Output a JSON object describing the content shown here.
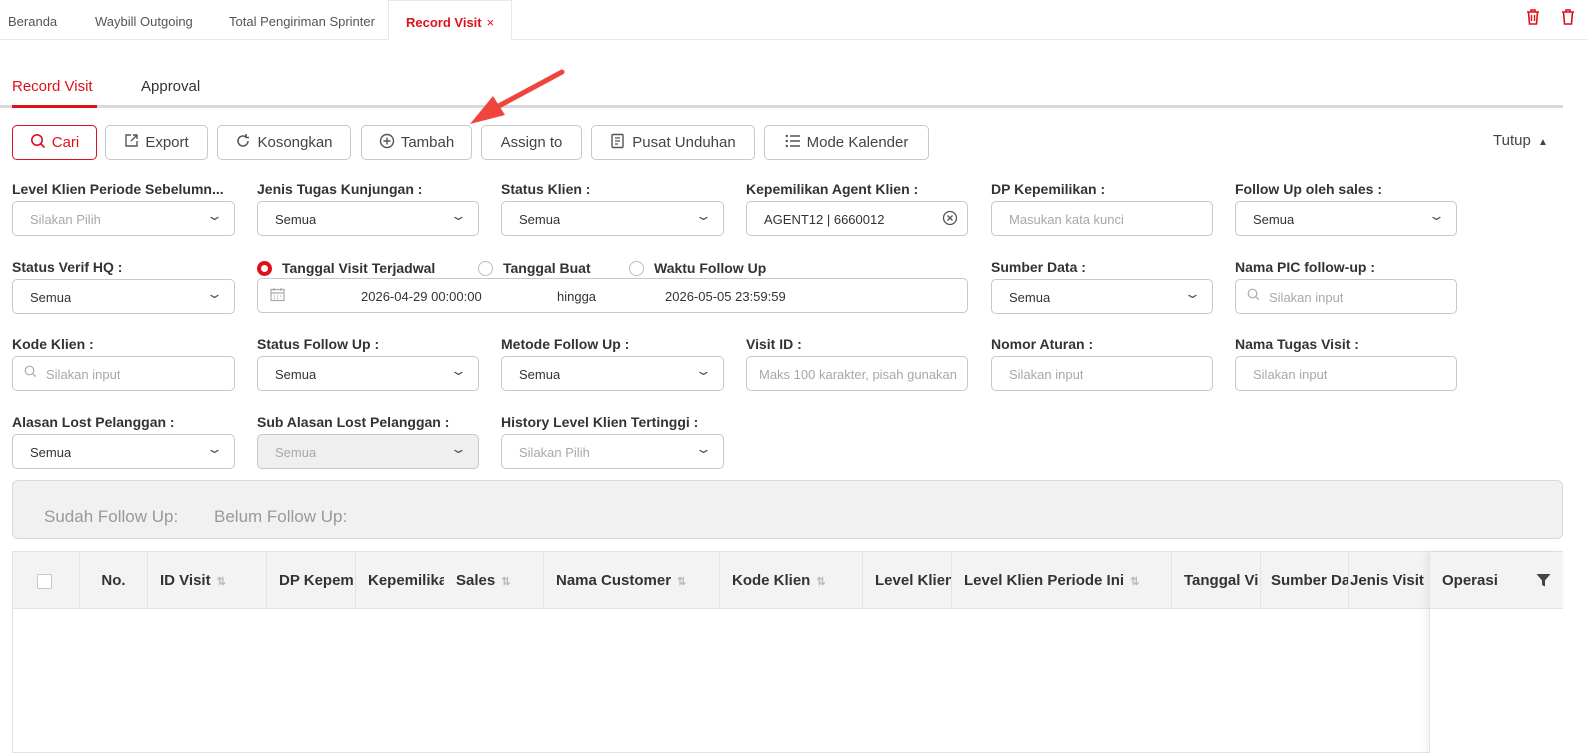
{
  "tabs": [
    "Beranda",
    "Waybill Outgoing",
    "Total Pengiriman Sprinter",
    "Record Visit"
  ],
  "tab_close": "×",
  "subtabs": [
    "Record Visit",
    "Approval"
  ],
  "toolbar": {
    "search": "Cari",
    "export": "Export",
    "clear": "Kosongkan",
    "add": "Tambah",
    "assign": "Assign to",
    "download_center": "Pusat Unduhan",
    "calendar_mode": "Mode Kalender",
    "collapse": "Tutup"
  },
  "filters": {
    "level_prev": {
      "label": "Level Klien Periode Sebelumn...",
      "value": "Silakan Pilih"
    },
    "visit_type": {
      "label": "Jenis Tugas Kunjungan :",
      "value": "Semua"
    },
    "client_status": {
      "label": "Status Klien :",
      "value": "Semua"
    },
    "agent_owner": {
      "label": "Kepemilikan Agent Klien :",
      "value": "AGENT12 | 6660012"
    },
    "dp_owner": {
      "label": "DP Kepemilikan :",
      "placeholder": "Masukan kata kunci"
    },
    "follow_sales": {
      "label": "Follow Up oleh sales :",
      "value": "Semua"
    },
    "verif_hq": {
      "label": "Status Verif HQ :",
      "value": "Semua"
    },
    "date_options": [
      "Tanggal Visit Terjadwal",
      "Tanggal Buat",
      "Waktu Follow Up"
    ],
    "date_start": "2026-04-29 00:00:00",
    "date_sep": "hingga",
    "date_end": "2026-05-05 23:59:59",
    "data_source": {
      "label": "Sumber Data :",
      "value": "Semua"
    },
    "pic_name": {
      "label": "Nama PIC follow-up :",
      "placeholder": "Silakan input"
    },
    "client_code": {
      "label": "Kode Klien :",
      "placeholder": "Silakan input"
    },
    "follow_status": {
      "label": "Status Follow Up :",
      "value": "Semua"
    },
    "follow_method": {
      "label": "Metode Follow Up :",
      "value": "Semua"
    },
    "visit_id": {
      "label": "Visit ID :",
      "placeholder": "Maks 100 karakter, pisah gunakan"
    },
    "rule_no": {
      "label": "Nomor Aturan :",
      "placeholder": "Silakan input"
    },
    "task_name": {
      "label": "Nama Tugas Visit :",
      "placeholder": "Silakan input"
    },
    "lost_reason": {
      "label": "Alasan Lost Pelanggan :",
      "value": "Semua"
    },
    "lost_sub": {
      "label": "Sub Alasan Lost Pelanggan :",
      "value": "Semua"
    },
    "level_history": {
      "label": "History Level Klien Tertinggi :",
      "value": "Silakan Pilih"
    }
  },
  "summary": {
    "done": "Sudah Follow Up:",
    "pending": "Belum Follow Up:"
  },
  "table": {
    "columns": [
      "No.",
      "ID Visit",
      "DP Kepem",
      "Kepemilika",
      "Sales",
      "Nama Customer",
      "Kode Klien",
      "Level Klien",
      "Level Klien Periode Ini",
      "Tanggal Vi",
      "Sumber Da",
      "Jenis Visit"
    ],
    "operation": "Operasi"
  },
  "colors": {
    "accent": "#e0101a"
  }
}
